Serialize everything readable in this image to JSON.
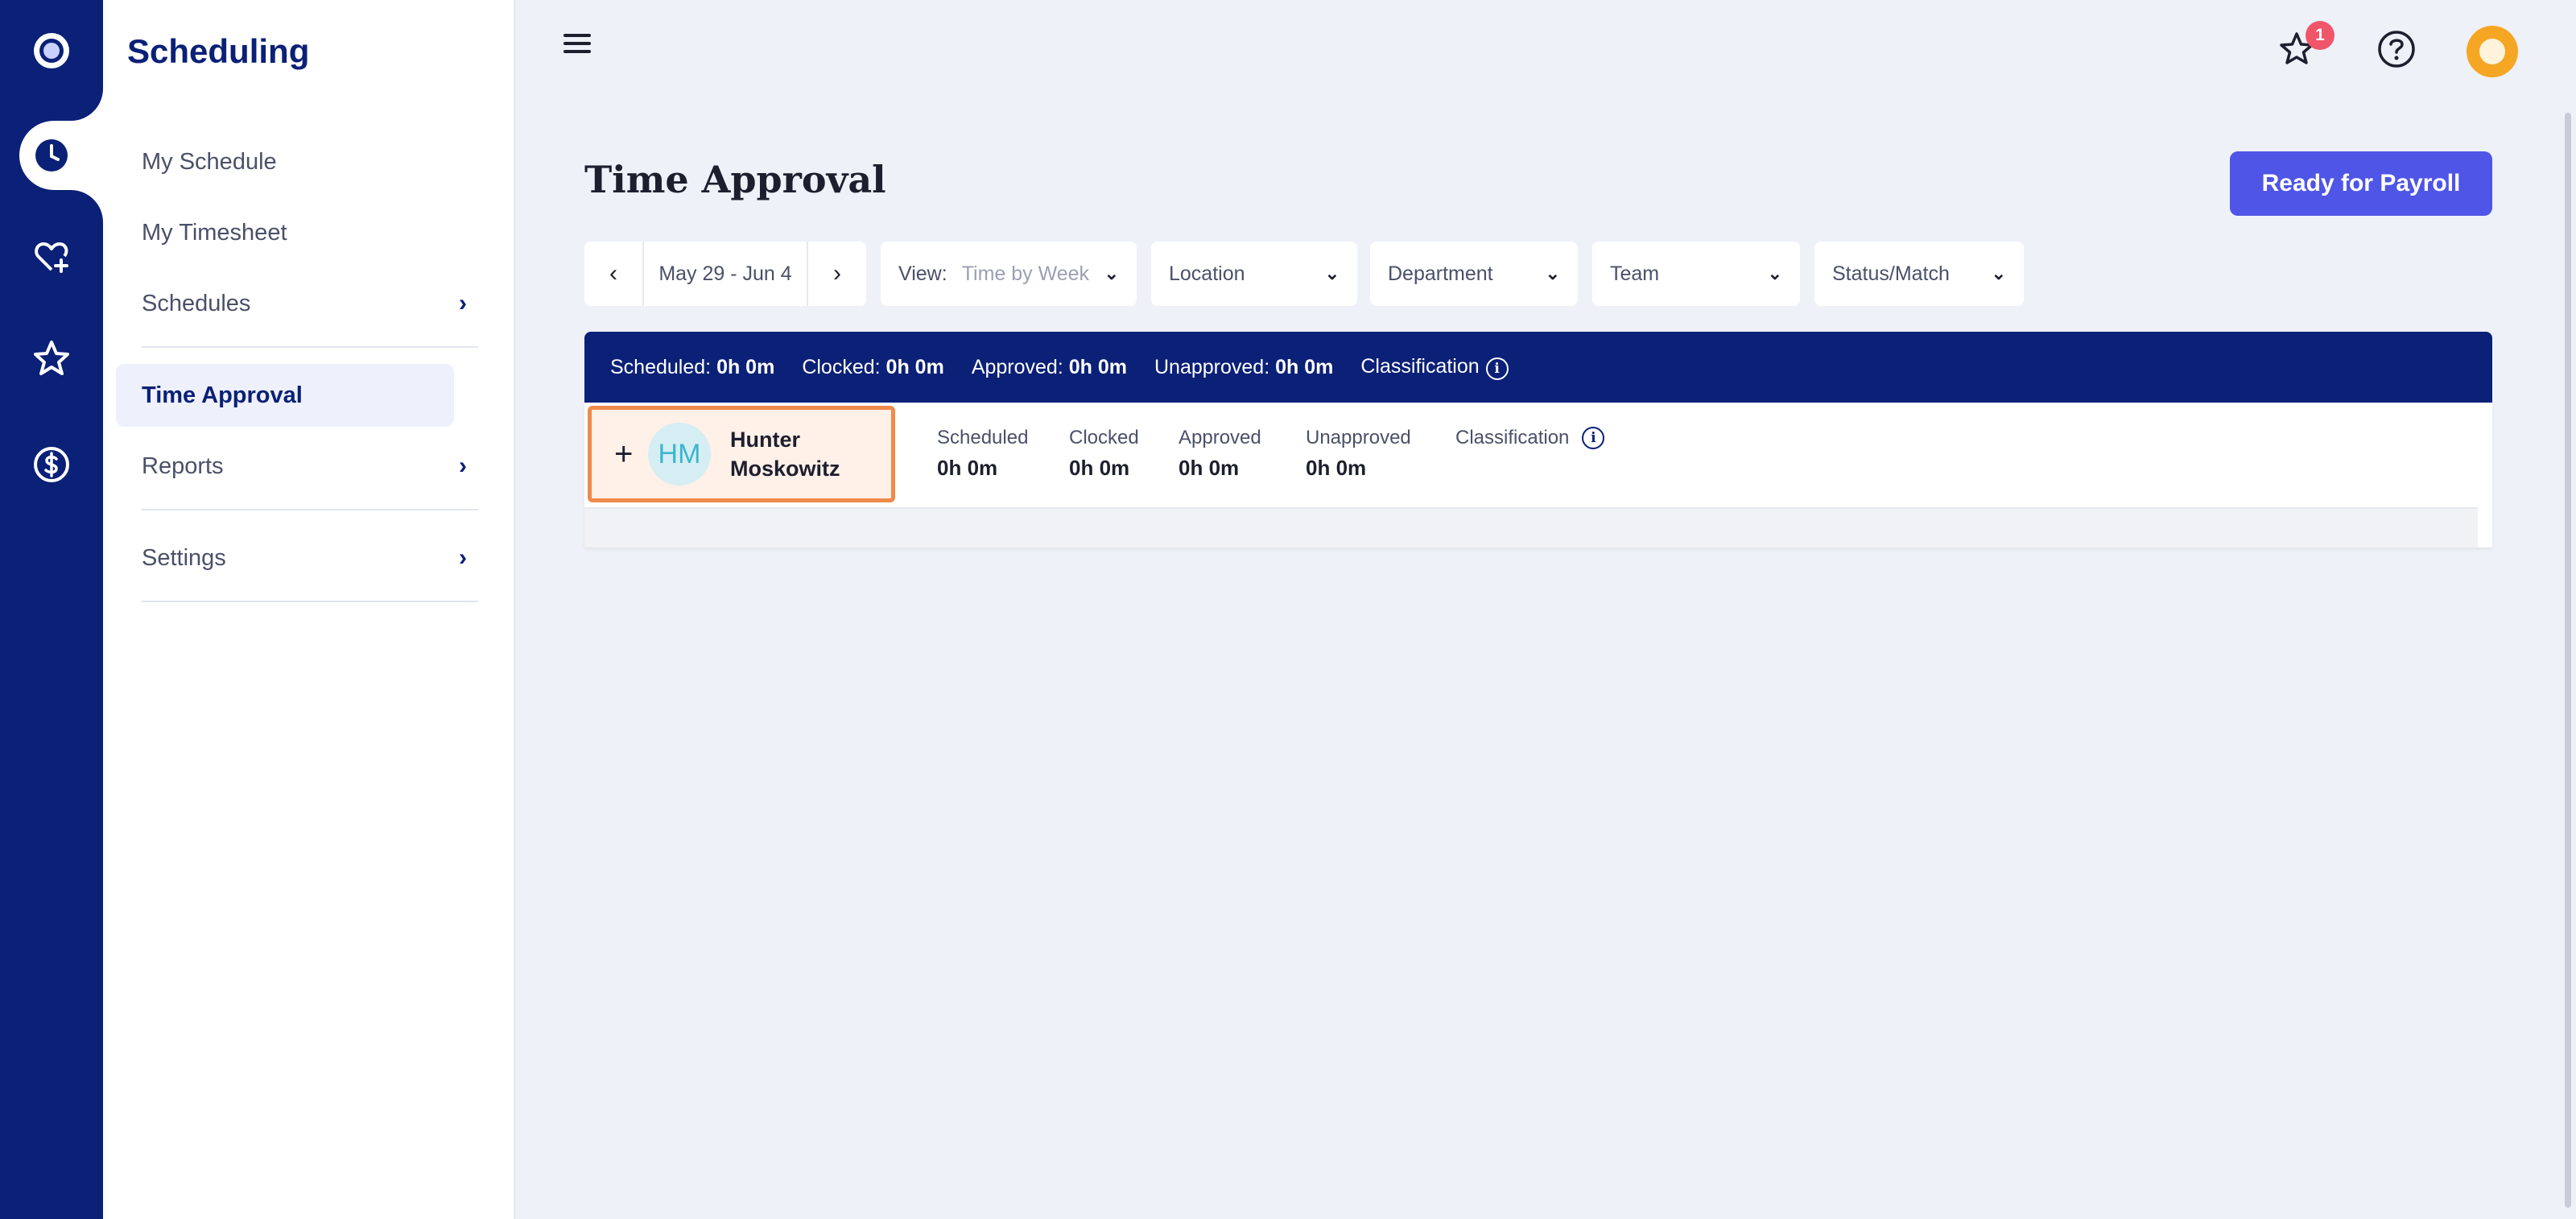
{
  "app": {
    "section_title": "Scheduling"
  },
  "rail": {
    "icons": [
      "logo-icon",
      "clock-icon",
      "heart-plus-icon",
      "star-icon",
      "dollar-icon"
    ],
    "active": "clock-icon"
  },
  "sidebar": {
    "items": [
      {
        "label": "My Schedule",
        "has_children": false
      },
      {
        "label": "My Timesheet",
        "has_children": false
      },
      {
        "label": "Schedules",
        "has_children": true
      },
      {
        "label": "Time Approval",
        "has_children": false,
        "active": true
      },
      {
        "label": "Reports",
        "has_children": true
      },
      {
        "label": "Settings",
        "has_children": true
      }
    ],
    "chevron": "›"
  },
  "topbar": {
    "notification_count": "1"
  },
  "page": {
    "title": "Time Approval",
    "primary_action": "Ready for Payroll"
  },
  "filters": {
    "prev": "‹",
    "next": "›",
    "date_range": "May 29 - Jun 4",
    "view_label": "View:",
    "view_value": "Time by Week",
    "location": "Location",
    "department": "Department",
    "team": "Team",
    "status": "Status/Match",
    "chevron": "⌄"
  },
  "summary": {
    "scheduled_label": "Scheduled:",
    "scheduled_value": "0h 0m",
    "clocked_label": "Clocked:",
    "clocked_value": "0h 0m",
    "approved_label": "Approved:",
    "approved_value": "0h 0m",
    "unapproved_label": "Unapproved:",
    "unapproved_value": "0h 0m",
    "classification_label": "Classification",
    "info_glyph": "i"
  },
  "employee": {
    "expand": "+",
    "initials": "HM",
    "first_name": "Hunter",
    "last_name": "Moskowitz",
    "stats": [
      {
        "label": "Scheduled",
        "value": "0h 0m"
      },
      {
        "label": "Clocked",
        "value": "0h 0m"
      },
      {
        "label": "Approved",
        "value": "0h 0m"
      },
      {
        "label": "Unapproved",
        "value": "0h 0m"
      }
    ],
    "classification_label": "Classification",
    "highlight_color": "#f08a4b"
  },
  "colors": {
    "brand_navy": "#0b2077",
    "accent_button": "#4f55e6",
    "badge_red": "#f0566a",
    "avatar_orange": "#f5a623"
  }
}
